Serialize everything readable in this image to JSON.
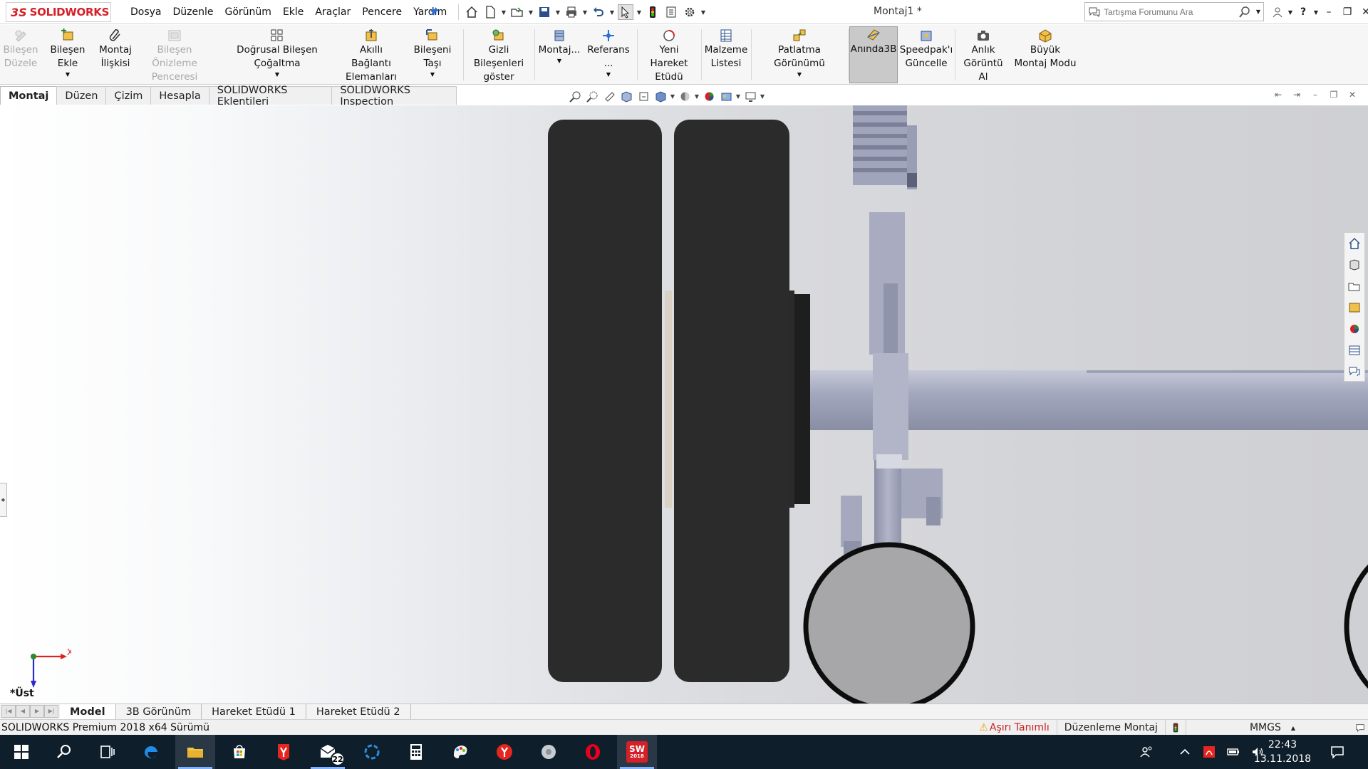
{
  "app": {
    "brand_prefix": "3S",
    "brand": "SOLIDWORKS",
    "document_title": "Montaj1 *"
  },
  "menu": [
    "Dosya",
    "Düzenle",
    "Görünüm",
    "Ekle",
    "Araçlar",
    "Pencere",
    "Yardım"
  ],
  "search": {
    "placeholder": "Tartışma Forumunu Ara"
  },
  "ribbon": {
    "bilesen_duzele": [
      "Bileşen",
      "Düzele"
    ],
    "bilesen_ekle": [
      "Bileşen Ekle"
    ],
    "montaj_iliskisi": [
      "Montaj",
      "İlişkisi"
    ],
    "bilesen_onizleme": [
      "Bileşen Önizleme",
      "Penceresi"
    ],
    "dogrusal": [
      "Doğrusal Bileşen Çoğaltma"
    ],
    "akilli": [
      "Akıllı Bağlantı",
      "Elemanları"
    ],
    "bileseni_tasi": [
      "Bileşeni Taşı"
    ],
    "gizli": [
      "Gizli Bileşenleri",
      "göster"
    ],
    "montaj_dd": [
      "Montaj..."
    ],
    "referans": [
      "Referans ..."
    ],
    "yeni_hareket": [
      "Yeni Hareket",
      "Etüdü"
    ],
    "malzeme": [
      "Malzeme",
      "Listesi"
    ],
    "patlatma": [
      "Patlatma Görünümü"
    ],
    "aninda3b": [
      "Anında3B"
    ],
    "speedpak": [
      "Speedpak'ı",
      "Güncelle"
    ],
    "anlik": [
      "Anlık",
      "Görüntü Al"
    ],
    "buyuk": [
      "Büyük",
      "Montaj Modu"
    ]
  },
  "command_tabs": [
    "Montaj",
    "Düzen",
    "Çizim",
    "Hesapla",
    "SOLIDWORKS Eklentileri",
    "SOLIDWORKS Inspection"
  ],
  "viewport": {
    "view_name": "*Üst",
    "triad_x": "X",
    "triad_y": "Y"
  },
  "bottom_tabs": [
    "Model",
    "3B Görünüm",
    "Hareket Etüdü 1",
    "Hareket Etüdü 2"
  ],
  "status": {
    "product": "SOLIDWORKS Premium 2018 x64 Sürümü",
    "warning": "Aşırı Tanımlı",
    "mode": "Düzenleme Montaj",
    "units": "MMGS"
  },
  "taskbar": {
    "mail_badge": "22",
    "sw_label": "SW",
    "sw_year": "2018"
  },
  "clock": {
    "time": "22:43",
    "date": "13.11.2018"
  },
  "colors": {
    "accent": "#d62028",
    "taskbar": "#0f1e2b",
    "tire": "#2b2b2b",
    "metal": "#9ea2b8"
  }
}
